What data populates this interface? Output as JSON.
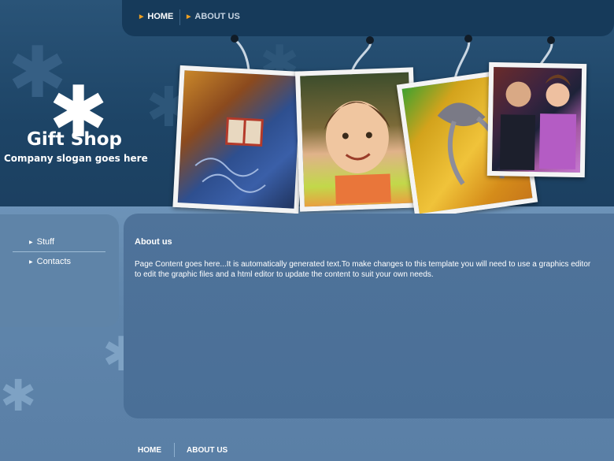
{
  "nav": {
    "items": [
      {
        "label": "HOME",
        "active": true
      },
      {
        "label": "ABOUT US",
        "active": false
      }
    ]
  },
  "logo": {
    "title": "Gift Shop",
    "slogan": "Company slogan goes here"
  },
  "sidebar": {
    "items": [
      {
        "label": "Stuff"
      },
      {
        "label": "Contacts"
      }
    ]
  },
  "content": {
    "title": "About us",
    "body": "Page Content goes here...It is automatically generated text.To make changes to this template you will need to use a graphics editor to edit the graphic files and a html editor to update the content to suit your own needs."
  },
  "footer": {
    "links": [
      {
        "label": "HOME"
      },
      {
        "label": "ABOUT US"
      }
    ]
  },
  "colors": {
    "header_bg": "#1d4466",
    "nav_bg": "#163a5a",
    "content_bg": "#4f739a",
    "accent_arrow": "#f0a020"
  }
}
